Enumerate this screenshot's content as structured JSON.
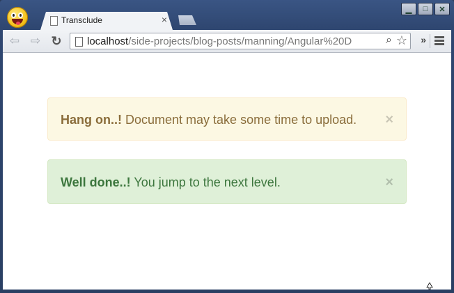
{
  "browser": {
    "tab_title": "Transclude",
    "tab_close": "×",
    "url_host": "localhost",
    "url_path": "/side-projects/blog-posts/manning/Angular%20D"
  },
  "window_controls": {
    "minimize": "▁",
    "maximize": "□",
    "close": "✕"
  },
  "alerts": [
    {
      "strong": "Hang on..!",
      "message": " Document may take some time to upload.",
      "dismiss": "×",
      "type": "warning"
    },
    {
      "strong": "Well done..!",
      "message": " You jump to the next level.",
      "dismiss": "×",
      "type": "success"
    }
  ],
  "colors": {
    "warning_bg": "#fcf8e3",
    "warning_text": "#8a6d3b",
    "success_bg": "#dff0d8",
    "success_text": "#3c763d"
  }
}
